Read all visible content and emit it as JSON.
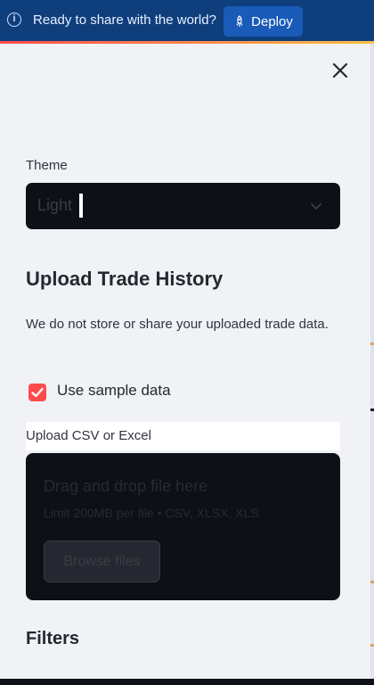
{
  "banner": {
    "message": "Ready to share with the world?",
    "deploy_label": "Deploy"
  },
  "sidebar": {
    "theme_label": "Theme",
    "theme_value": "Light",
    "upload_heading": "Upload Trade History",
    "privacy_note": "We do not store or share your uploaded trade data.",
    "sample_checkbox_label": "Use sample data",
    "sample_checked": true,
    "upload_label": "Upload CSV or Excel",
    "dropzone_title": "Drag and drop file here",
    "dropzone_limit": "Limit 200MB per file • CSV, XLSX, XLS",
    "browse_label": "Browse files",
    "filters_heading": "Filters"
  },
  "colors": {
    "banner_bg": "#0f3e7d",
    "accent": "#ff4b4b",
    "panel_bg": "#f0f2f6",
    "dark_widget": "#0d1017"
  },
  "icons": [
    "info-icon",
    "rocket-icon",
    "close-icon",
    "chevron-down-icon",
    "checkmark-icon"
  ]
}
